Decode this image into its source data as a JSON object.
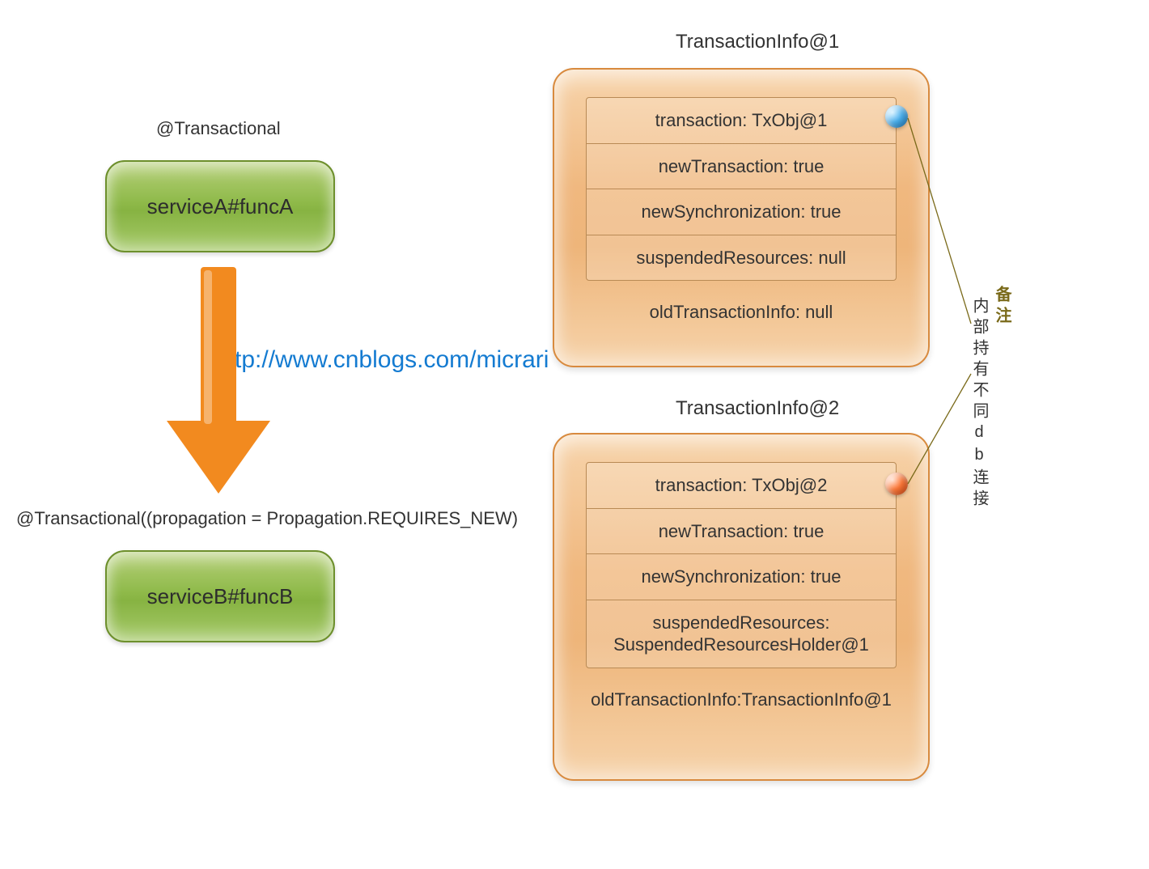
{
  "left": {
    "topAnnotation": "@Transactional",
    "serviceA": "serviceA#funcA",
    "bottomAnnotation": "@Transactional((propagation = Propagation.REQUIRES_NEW)",
    "serviceB": "serviceB#funcB"
  },
  "watermark": "http://www.cnblogs.com/micrari",
  "panel1": {
    "title": "TransactionInfo@1",
    "rows": [
      "transaction: TxObj@1",
      "newTransaction: true",
      "newSynchronization: true",
      "suspendedResources: null"
    ],
    "footer": "oldTransactionInfo: null"
  },
  "panel2": {
    "title": "TransactionInfo@2",
    "rows": [
      "transaction: TxObj@2",
      "newTransaction: true",
      "newSynchronization: true",
      "suspendedResources: SuspendedResourcesHolder@1"
    ],
    "footer": "oldTransactionInfo:TransactionInfo@1"
  },
  "note": {
    "header": "备注",
    "body": "内部持有不同db连接"
  },
  "colors": {
    "arrow": "#f28a1f",
    "link": "#147bd1",
    "greenBorder": "#6d8f2c",
    "orangeBorder": "#d88a3e"
  }
}
